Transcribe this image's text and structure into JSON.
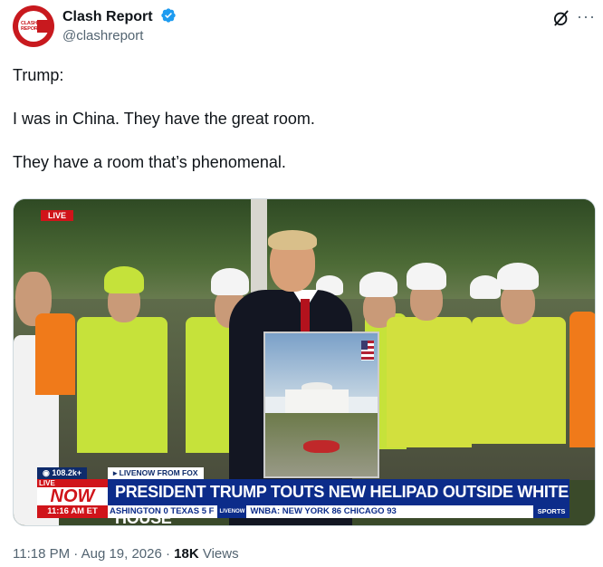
{
  "account": {
    "avatar_text": "CLASH REPORT",
    "name": "Clash Report",
    "handle": "@clashreport"
  },
  "post": {
    "line1": "Trump:",
    "line2": "I was in China. They have the great room.",
    "line3": "They have a room that’s phenomenal."
  },
  "video": {
    "live_tag": "LIVE",
    "viewers": "108.2k+",
    "source": "▸ LIVENOW FROM FOX",
    "live_small": "LIVE",
    "now": "NOW",
    "headline": "PRESIDENT TRUMP TOUTS NEW HELIPAD OUTSIDE WHITE HOUSE",
    "time": "11:16 AM ET",
    "ticker_left": "ASHINGTON  0  TEXAS  5  F",
    "ticker_badge": "LIVENOW",
    "ticker_right": "WNBA:  NEW YORK  86  CHICAGO  93",
    "sports": "SPORTS"
  },
  "footer": {
    "timestamp": "11:18 PM · Aug 19, 2026 · ",
    "views_count": "18K",
    "views_label": " Views"
  },
  "icons": {
    "verified": "verified-badge-icon",
    "grok": "grok-icon",
    "more": "more-icon"
  },
  "colors": {
    "verified_blue": "#1d9bf0",
    "brand_red": "#c8191e",
    "fox_blue": "#0c2c8a"
  }
}
